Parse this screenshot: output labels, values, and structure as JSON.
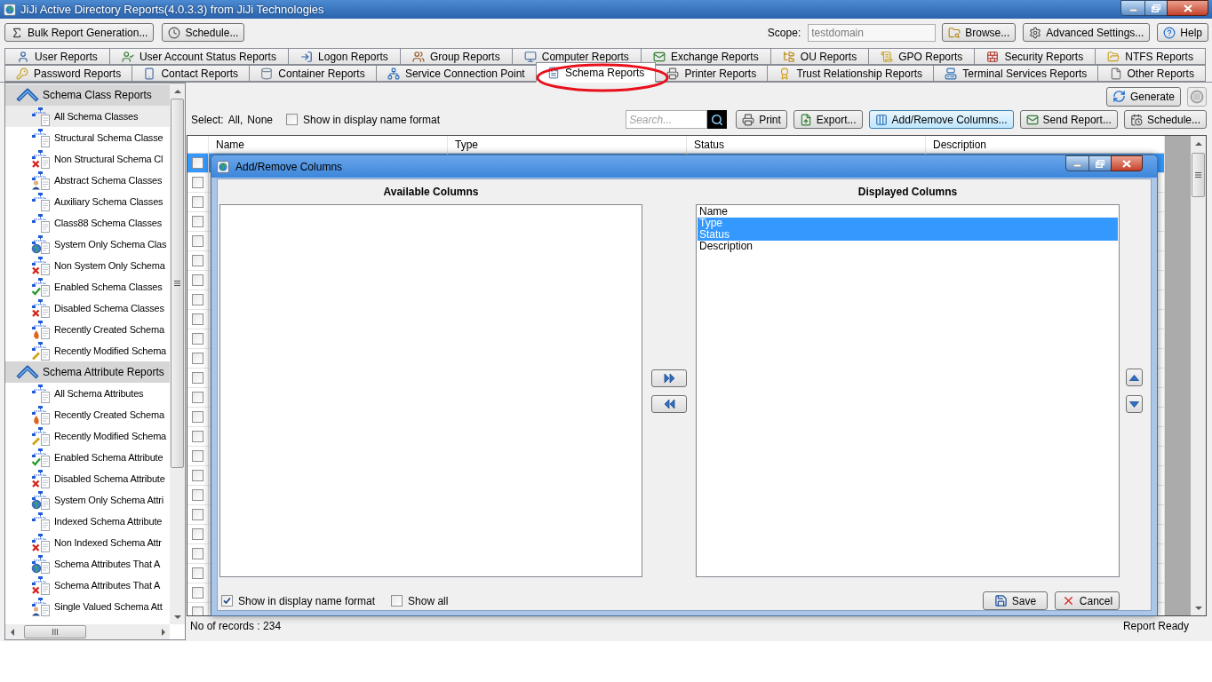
{
  "window": {
    "title": "JiJi Active Directory Reports(4.0.3.3) from JiJi Technologies"
  },
  "toolbar": {
    "left_buttons": [
      "Bulk Report Generation...",
      "Schedule..."
    ],
    "scope": {
      "label": "Scope:",
      "value": "testdomain"
    },
    "right_buttons": [
      "Browse...",
      "Advanced Settings...",
      "Help"
    ]
  },
  "tab_rows": [
    {
      "tabs": [
        {
          "label": "User Reports",
          "selected": false
        },
        {
          "label": "User Account Status Reports",
          "selected": false
        },
        {
          "label": "Logon Reports",
          "selected": false
        },
        {
          "label": "Group Reports",
          "selected": false
        },
        {
          "label": "Computer Reports",
          "selected": false
        },
        {
          "label": "Exchange Reports",
          "selected": false
        },
        {
          "label": "OU Reports",
          "selected": false
        },
        {
          "label": "GPO Reports",
          "selected": false
        },
        {
          "label": "Security Reports",
          "selected": false
        },
        {
          "label": "NTFS Reports",
          "selected": false
        }
      ]
    },
    {
      "tabs": [
        {
          "label": "Password Reports",
          "selected": false
        },
        {
          "label": "Contact Reports",
          "selected": false
        },
        {
          "label": "Container Reports",
          "selected": false
        },
        {
          "label": "Service Connection Point",
          "selected": false
        },
        {
          "label": "Schema Reports",
          "selected": true
        },
        {
          "label": "Printer Reports",
          "selected": false
        },
        {
          "label": "Trust Relationship Reports",
          "selected": false
        },
        {
          "label": "Terminal Services Reports",
          "selected": false
        },
        {
          "label": "Other Reports",
          "selected": false
        }
      ]
    }
  ],
  "sidebar": {
    "groups": [
      {
        "title": "Schema Class Reports",
        "expanded": true,
        "items": [
          {
            "label": "All Schema Classes",
            "selected": true
          },
          {
            "label": "Structural Schema Classe",
            "selected": false
          },
          {
            "label": "Non Structural Schema Cl",
            "selected": false
          },
          {
            "label": "Abstract Schema Classes",
            "selected": false
          },
          {
            "label": "Auxiliary Schema Classes",
            "selected": false
          },
          {
            "label": "Class88 Schema Classes",
            "selected": false
          },
          {
            "label": "System Only Schema Clas",
            "selected": false
          },
          {
            "label": "Non System Only Schema",
            "selected": false
          },
          {
            "label": "Enabled Schema Classes",
            "selected": false
          },
          {
            "label": "Disabled Schema Classes",
            "selected": false
          },
          {
            "label": "Recently Created Schema",
            "selected": false
          },
          {
            "label": "Recently Modified Schema",
            "selected": false
          }
        ]
      },
      {
        "title": "Schema Attribute Reports",
        "expanded": true,
        "items": [
          {
            "label": "All Schema Attributes",
            "selected": false
          },
          {
            "label": "Recently Created Schema",
            "selected": false
          },
          {
            "label": "Recently Modified Schema",
            "selected": false
          },
          {
            "label": "Enabled Schema Attribute",
            "selected": false
          },
          {
            "label": "Disabled Schema Attribute",
            "selected": false
          },
          {
            "label": "System Only Schema Attri",
            "selected": false
          },
          {
            "label": "Indexed Schema Attribute",
            "selected": false
          },
          {
            "label": "Non Indexed Schema Attr",
            "selected": false
          },
          {
            "label": "Schema Attributes That A",
            "selected": false
          },
          {
            "label": "Schema Attributes That A",
            "selected": false
          },
          {
            "label": "Single Valued Schema Att",
            "selected": false
          }
        ]
      }
    ]
  },
  "report": {
    "generate_button": "Generate",
    "select": {
      "label": "Select:",
      "links": [
        "All,",
        "None"
      ]
    },
    "display_name_format": {
      "label": "Show in display name format",
      "checked": false
    },
    "search": {
      "placeholder": "Search..."
    },
    "buttons": [
      {
        "label": "Print",
        "focused": false
      },
      {
        "label": "Export...",
        "focused": false
      },
      {
        "label": "Add/Remove Columns...",
        "focused": true
      },
      {
        "label": "Send Report...",
        "focused": false
      },
      {
        "label": "Schedule...",
        "focused": false
      }
    ],
    "grid": {
      "columns": [
        "Name",
        "Type",
        "Status",
        "Description"
      ],
      "rows": [
        {
          "selected": true,
          "checked": false
        },
        {
          "selected": false,
          "checked": false
        },
        {
          "selected": false,
          "checked": false
        },
        {
          "selected": false,
          "checked": false
        },
        {
          "selected": false,
          "checked": false
        },
        {
          "selected": false,
          "checked": false
        },
        {
          "selected": false,
          "checked": false
        },
        {
          "selected": false,
          "checked": false
        },
        {
          "selected": false,
          "checked": false
        },
        {
          "selected": false,
          "checked": false
        },
        {
          "selected": false,
          "checked": false
        },
        {
          "selected": false,
          "checked": false
        },
        {
          "selected": false,
          "checked": false
        },
        {
          "selected": false,
          "checked": false
        },
        {
          "selected": false,
          "checked": false
        },
        {
          "selected": false,
          "checked": false
        },
        {
          "selected": false,
          "checked": false
        },
        {
          "selected": false,
          "checked": false
        },
        {
          "selected": false,
          "checked": false
        },
        {
          "selected": false,
          "checked": false
        },
        {
          "selected": false,
          "checked": false
        },
        {
          "selected": false,
          "checked": false
        },
        {
          "selected": false,
          "checked": false
        },
        {
          "selected": false,
          "checked": false
        }
      ]
    }
  },
  "dialog": {
    "title": "Add/Remove Columns",
    "available": {
      "heading": "Available Columns"
    },
    "displayed": {
      "heading": "Displayed Columns",
      "items": [
        {
          "label": "Name",
          "selected": false
        },
        {
          "label": "Type",
          "selected": true
        },
        {
          "label": "Status",
          "selected": true
        },
        {
          "label": "Description",
          "selected": false
        }
      ]
    },
    "options": [
      {
        "label": "Show in display name format",
        "checked": true
      },
      {
        "label": "Show all",
        "checked": false
      }
    ],
    "buttons": [
      "Save",
      "Cancel"
    ]
  },
  "status_bar": {
    "records": "No of records : 234",
    "status": "Report Ready"
  }
}
